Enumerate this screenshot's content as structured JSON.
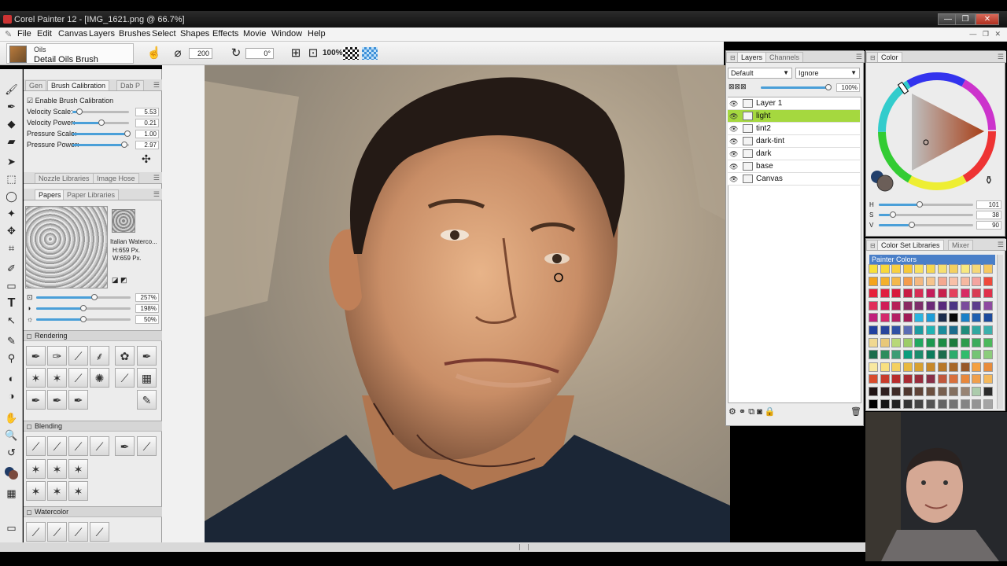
{
  "window": {
    "title": "Corel Painter 12 - [IMG_1621.png @ 66.7%]"
  },
  "menu": [
    "File",
    "Edit",
    "Canvas",
    "Layers",
    "Brushes",
    "Select",
    "Shapes",
    "Effects",
    "Movie",
    "Window",
    "Help"
  ],
  "propbar": {
    "brush_category": "Oils",
    "brush_variant": "Detail Oils Brush",
    "size_value": "200",
    "angle_value": "0°",
    "zoom_label": "100%"
  },
  "brush_calibration": {
    "tabs": [
      "Gen",
      "Brush Calibration",
      "Dab P"
    ],
    "enable_label": "Enable Brush Calibration",
    "rows": [
      {
        "label": "Velocity Scale:",
        "value": "5.53",
        "level": 0.1
      },
      {
        "label": "Velocity Power:",
        "value": "0.21",
        "level": 0.5
      },
      {
        "label": "Pressure Scale:",
        "value": "1.00",
        "level": 1.0
      },
      {
        "label": "Pressure Power:",
        "value": "2.97",
        "level": 0.95
      }
    ]
  },
  "nozzle_tabs": [
    "Nozzle Libraries",
    "Image Hose"
  ],
  "paper_tabs": [
    "Papers",
    "Paper Libraries"
  ],
  "paper": {
    "name": "Italian Waterco...",
    "height": "H:659 Px.",
    "width": "W:659 Px.",
    "sliders": [
      {
        "value": "257%",
        "level": 0.6
      },
      {
        "value": "198%",
        "level": 0.5
      },
      {
        "value": "50%",
        "level": 0.5
      }
    ]
  },
  "sections": {
    "rendering": "Rendering",
    "blending": "Blending",
    "watercolor": "Watercolor"
  },
  "layers_panel": {
    "tabs": [
      "Layers",
      "Channels"
    ],
    "composite_method": "Default",
    "preserve": "Ignore",
    "opacity": "100%",
    "layers": [
      {
        "name": "Layer 1",
        "selected": false
      },
      {
        "name": "light",
        "selected": true
      },
      {
        "name": "tint2",
        "selected": false
      },
      {
        "name": "dark-tint",
        "selected": false
      },
      {
        "name": "dark",
        "selected": false
      },
      {
        "name": "base",
        "selected": false
      },
      {
        "name": "Canvas",
        "selected": false
      }
    ]
  },
  "color_panel": {
    "tab": "Color",
    "h_label": "H",
    "s_label": "S",
    "v_label": "V",
    "h_value": "101",
    "s_value": "38",
    "v_value": "90",
    "h_level": 0.42,
    "s_level": 0.1,
    "v_level": 0.3
  },
  "color_set": {
    "tabs": [
      "Color Set Libraries",
      "Mixer"
    ],
    "title": "Painter Colors",
    "rows": [
      [
        "#f8e03a",
        "#f8d83a",
        "#f8d040",
        "#f6c838",
        "#f8e060",
        "#f6d850",
        "#f6e070",
        "#f4d060",
        "#f8e880",
        "#f6d878",
        "#f6c860"
      ],
      [
        "#f4a41c",
        "#f4b02c",
        "#f4b84a",
        "#f49c4c",
        "#f4b880",
        "#f6c48c",
        "#f4a890",
        "#f8c0a8",
        "#f6b8a0",
        "#f4a4a0",
        "#ef4a3c"
      ],
      [
        "#e6203a",
        "#e02040",
        "#d8183c",
        "#c81c44",
        "#d82c54",
        "#c41c5a",
        "#c8204c",
        "#e4405c",
        "#d82a64",
        "#d83c54",
        "#e0304a"
      ],
      [
        "#e02c5a",
        "#d01e58",
        "#b61e58",
        "#8a2a62",
        "#7e2e6a",
        "#6c2a78",
        "#5a2a7c",
        "#4c3484",
        "#7a4c9c",
        "#5c3c8c",
        "#8e4aa0"
      ],
      [
        "#c0207c",
        "#d4286c",
        "#b42064",
        "#a01c58",
        "#2ab4e0",
        "#1c9cd8",
        "#1c2c4c",
        "#0a0a0a",
        "#1a80c8",
        "#2060b0",
        "#1c4a9c"
      ],
      [
        "#2040a0",
        "#28449c",
        "#3050a4",
        "#5a6cb4",
        "#1c9ca0",
        "#20b4b4",
        "#1c8c9c",
        "#1c6c8c",
        "#208c7c",
        "#30a8a0",
        "#3cb0ac"
      ],
      [
        "#f0d890",
        "#e8c878",
        "#b8d878",
        "#9ccc68",
        "#20a860",
        "#1c9850",
        "#1c8c44",
        "#1c7c3c",
        "#2c9c4c",
        "#3cac5c",
        "#4cb85c"
      ],
      [
        "#1c6c4c",
        "#2c8c5c",
        "#3c9c74",
        "#0c9c7c",
        "#1c8c6c",
        "#0c7c5c",
        "#1c6c4c",
        "#2cac6c",
        "#30bc6c",
        "#74c474",
        "#8ccc7c"
      ],
      [
        "#f8e8a0",
        "#f8e080",
        "#f4d060",
        "#e8b840",
        "#d8a030",
        "#c88828",
        "#b87828",
        "#a86828",
        "#985828",
        "#f4a040",
        "#e88c3c"
      ],
      [
        "#d84c2c",
        "#c83c2c",
        "#b82c2c",
        "#a82c34",
        "#982c3c",
        "#883048",
        "#c0583c",
        "#d8703c",
        "#e8883c",
        "#f0a04c",
        "#f4b85c"
      ],
      [
        "#201414",
        "#302020",
        "#402c28",
        "#503830",
        "#604438",
        "#6c5040",
        "#786050",
        "#847060",
        "#988474",
        "#acccac",
        "#2c2c2c"
      ],
      [
        "#000000",
        "#141414",
        "#242424",
        "#343434",
        "#444444",
        "#545454",
        "#646464",
        "#747474",
        "#848484",
        "#949494",
        "#a4a4a4"
      ]
    ]
  }
}
